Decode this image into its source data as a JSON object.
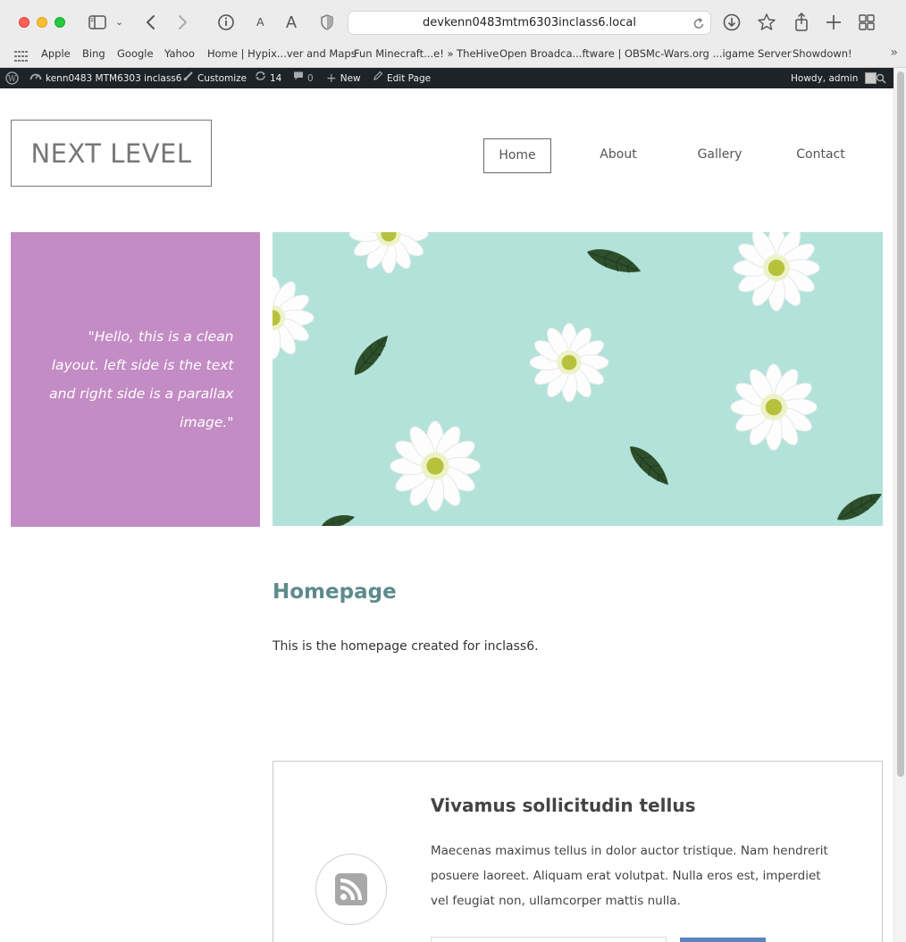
{
  "browser": {
    "url": "devkenn0483mtm6303inclass6.local",
    "text_small": "A",
    "text_large": "A",
    "bookmarks": [
      "Apple",
      "Bing",
      "Google",
      "Yahoo",
      "Home | Hypix...ver and Maps",
      "Fun Minecraft...e! » TheHive",
      "Open Broadca...ftware | OBS",
      "Mc-Wars.org ...igame Server",
      "Showdown!"
    ],
    "more_bookmarks": "»"
  },
  "adminbar": {
    "site_name": "kenn0483 MTM6303 inclass6",
    "customize": "Customize",
    "updates": "14",
    "comments": "0",
    "new": "New",
    "edit_page": "Edit Page",
    "howdy": "Howdy, admin"
  },
  "site": {
    "logo": "NEXT LEVEL",
    "nav": [
      "Home",
      "About",
      "Gallery",
      "Contact"
    ],
    "active_nav": "Home"
  },
  "hero": {
    "quote": "\"Hello, this is a clean layout. left side is the text and right side is a parallax image.\""
  },
  "content": {
    "title": "Homepage",
    "text": "This is the homepage created for inclass6."
  },
  "feature": {
    "title": "Vivamus sollicitudin tellus",
    "text": "Maecenas maximus tellus in dolor auctor tristique. Nam hendrerit posuere laoreet. Aliquam erat volutpat. Nulla eros est, imperdiet vel feugiat non, ullamcorper mattis nulla.",
    "icon": "rss-icon"
  },
  "colors": {
    "quote_panel": "#c38cc4",
    "hero_bg": "#b3e2da",
    "title_teal": "#5d8b8c",
    "button_blue": "#5b86bd",
    "adminbar": "#1d2327"
  }
}
